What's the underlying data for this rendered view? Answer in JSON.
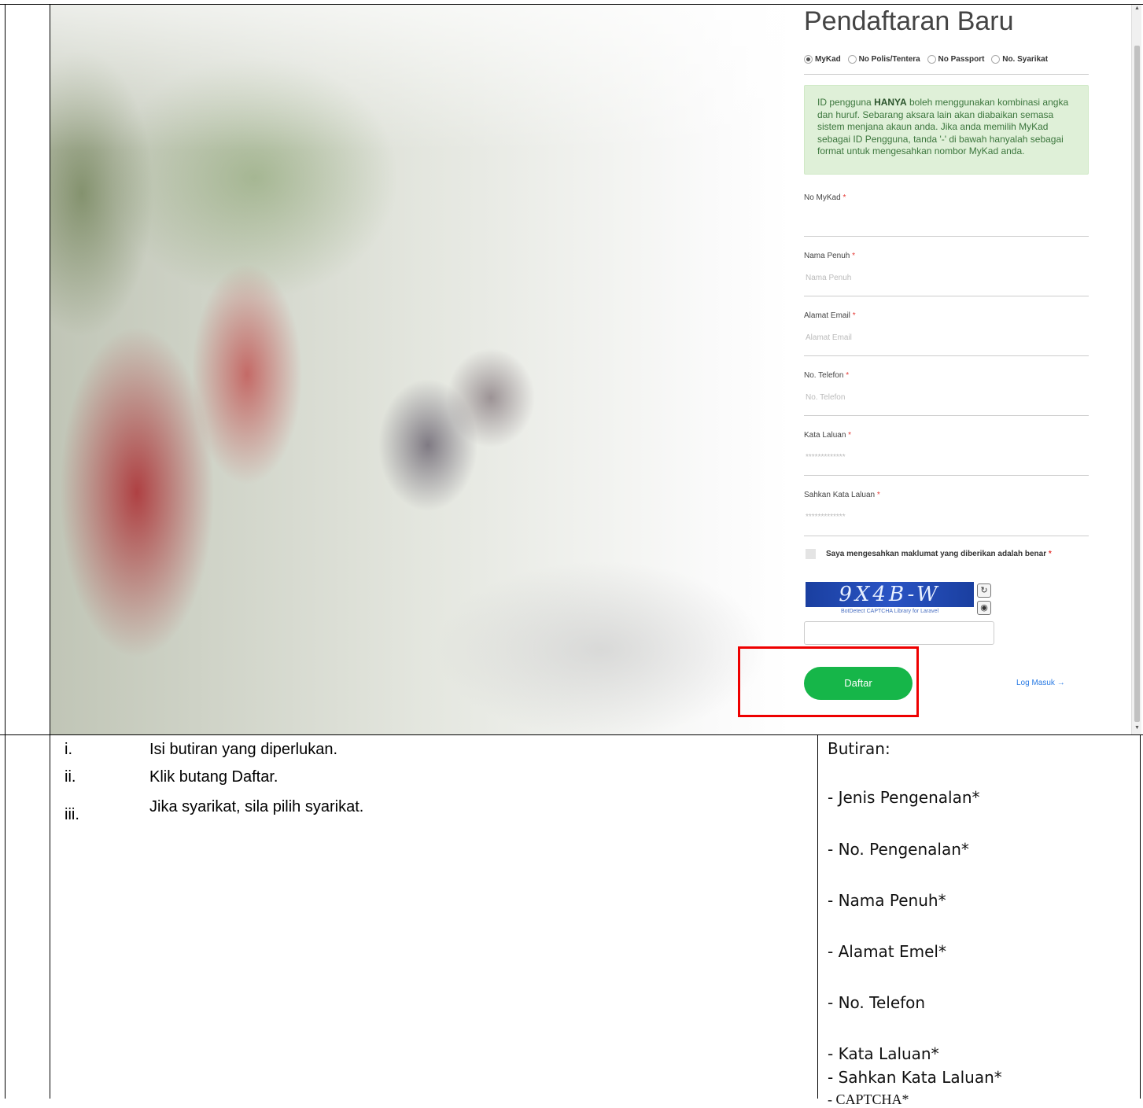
{
  "form": {
    "title": "Pendaftaran Baru",
    "radios": [
      {
        "label": "MyKad",
        "selected": true
      },
      {
        "label": "No Polis/Tentera",
        "selected": false
      },
      {
        "label": "No Passport",
        "selected": false
      },
      {
        "label": "No. Syarikat",
        "selected": false
      }
    ],
    "notice_prefix": "ID pengguna ",
    "notice_bold": "HANYA",
    "notice_suffix": " boleh menggunakan kombinasi angka dan huruf. Sebarang aksara lain akan diabaikan semasa sistem menjana akaun anda. Jika anda memilih MyKad sebagai ID Pengguna, tanda '-' di bawah hanyalah sebagai format untuk mengesahkan nombor MyKad anda.",
    "fields": [
      {
        "label": "No MyKad",
        "placeholder": ""
      },
      {
        "label": "Nama Penuh",
        "placeholder": "Nama Penuh"
      },
      {
        "label": "Alamat Email",
        "placeholder": "Alamat Email"
      },
      {
        "label": "No. Telefon",
        "placeholder": "No. Telefon"
      },
      {
        "label": "Kata Laluan",
        "placeholder": "*************"
      },
      {
        "label": "Sahkan Kata Laluan",
        "placeholder": "*************"
      }
    ],
    "required_mark": "*",
    "checkbox_label": "Saya mengesahkan maklumat yang diberikan adalah benar",
    "captcha_text": "9X4B-W",
    "captcha_caption": "BotDetect CAPTCHA Library for Laravel",
    "submit_label": "Daftar",
    "login_link": "Log Masuk →",
    "accent_color": "#16b649"
  },
  "steps": [
    {
      "num": "i.",
      "text": "Isi butiran yang diperlukan."
    },
    {
      "num": "ii.",
      "text": "Klik butang Daftar."
    },
    {
      "num": "iii.",
      "text": "Jika syarikat, sila pilih syarikat."
    }
  ],
  "details": {
    "heading": "Butiran:",
    "items": [
      "- Jenis Pengenalan*",
      "- No. Pengenalan*",
      "- Nama Penuh*",
      "- Alamat Emel*",
      "- No. Telefon",
      "- Kata Laluan*",
      "- Sahkan Kata Laluan*",
      "- CAPTCHA*"
    ]
  }
}
